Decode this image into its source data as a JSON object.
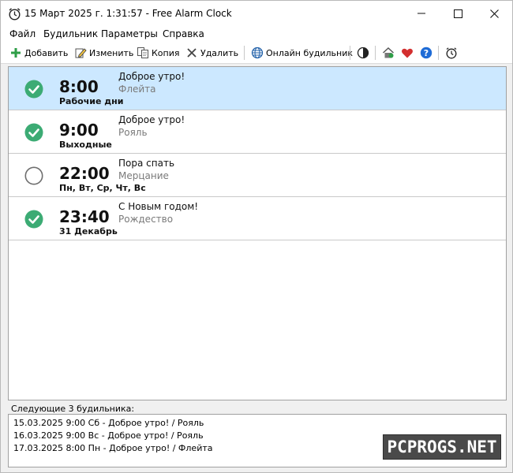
{
  "window": {
    "title": "15 Март 2025 г. 1:31:57 - Free Alarm Clock"
  },
  "menu": [
    "Файл",
    "Будильник",
    "Параметры",
    "Справка"
  ],
  "toolbar": {
    "add": "Добавить",
    "edit": "Изменить",
    "copy": "Копия",
    "delete": "Удалить",
    "online": "Онлайн будильник"
  },
  "alarms": [
    {
      "time": "8:00",
      "days": "Рабочие дни",
      "label": "Доброе утро!",
      "sound": "Флейта",
      "enabled": true,
      "selected": true
    },
    {
      "time": "9:00",
      "days": "Выходные",
      "label": "Доброе утро!",
      "sound": "Рояль",
      "enabled": true,
      "selected": false
    },
    {
      "time": "22:00",
      "days": "Пн, Вт, Ср, Чт, Вс",
      "label": "Пора спать",
      "sound": "Мерцание",
      "enabled": false,
      "selected": false
    },
    {
      "time": "23:40",
      "days": "31 Декабрь",
      "label": "С Новым годом!",
      "sound": "Рождество",
      "enabled": true,
      "selected": false
    }
  ],
  "next_alarms": {
    "title": "Следующие 3 будильника:",
    "items": [
      "15.03.2025 9:00 Сб - Доброе утро! / Рояль",
      "16.03.2025 9:00 Вс - Доброе утро! / Рояль",
      "17.03.2025 8:00 Пн - Доброе утро! / Флейта"
    ]
  },
  "watermark": "PCPROGS.NET",
  "colors": {
    "check_green": "#3cab74",
    "selected_row": "#cce8ff",
    "heart_red": "#d32f2f",
    "help_blue": "#1e6bd6"
  }
}
